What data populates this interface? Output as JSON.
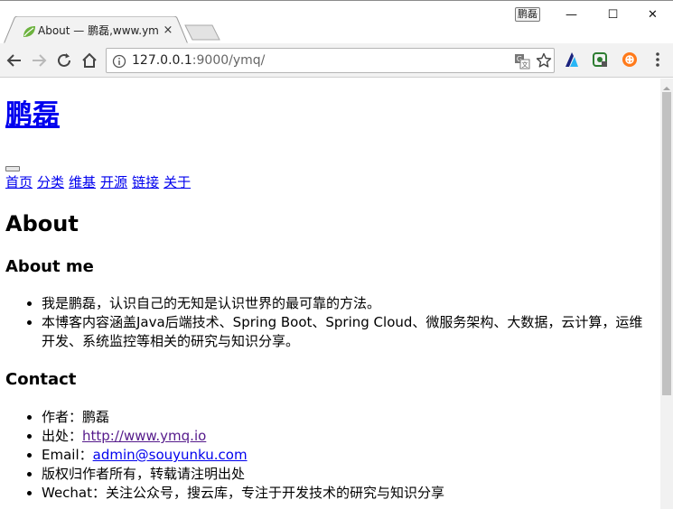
{
  "window": {
    "profile_name": "鹏磊",
    "minimize_glyph": "—",
    "maximize_glyph": "☐",
    "close_glyph": "✕"
  },
  "tab": {
    "title": "About — 鹏磊,www.ym",
    "close_glyph": "×",
    "favicon": "leaf-icon"
  },
  "toolbar": {
    "url_host": "127.0.0.1",
    "url_rest": ":9000/ymq/",
    "icons": [
      "back-arrow-icon",
      "forward-arrow-icon",
      "reload-icon",
      "home-icon",
      "page-info-icon",
      "translate-icon",
      "star-icon",
      "extension-a-icon",
      "extension-b-icon",
      "extension-c-icon",
      "menu-icon"
    ]
  },
  "page": {
    "site_title": "鹏磊",
    "nav": [
      "首页",
      "分类",
      "维基",
      "开源",
      "链接",
      "关于"
    ],
    "heading": "About",
    "about_me": {
      "heading": "About me",
      "items": [
        "我是鹏磊，认识自己的无知是认识世界的最可靠的方法。",
        "本博客内容涵盖Java后端技术、Spring Boot、Spring Cloud、微服务架构、大数据，云计算，运维开发、系统监控等相关的研究与知识分享。"
      ]
    },
    "contact": {
      "heading": "Contact",
      "author_label": "作者：",
      "author_value": "鹏磊",
      "source_label": "出处：",
      "source_link": "http://www.ymq.io",
      "email_label": "Email：",
      "email_link": "admin@souyunku.com",
      "copyright": "版权归作者所有，转载请注明出处",
      "wechat": "Wechat：关注公众号，搜云库，专注于开发技术的研究与知识分享"
    }
  },
  "colors": {
    "link": "#0000ee",
    "visited_link": "#551a8b",
    "chrome_toolbar": "#f2f2f2",
    "scroll_thumb": "#c1c1c1"
  }
}
